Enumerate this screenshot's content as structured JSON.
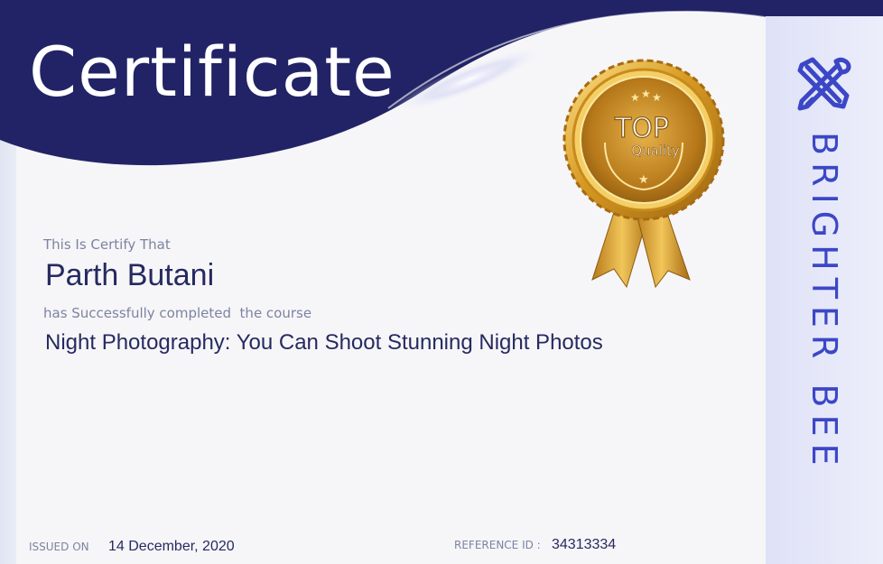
{
  "certificate": {
    "title": "Certificate",
    "certify_text": "This Is Certify That",
    "recipient_name": "Parth Butani",
    "completion_text": "has Successfully completed  the course",
    "course_name": "Night Photography: You Can Shoot Stunning Night Photos"
  },
  "footer": {
    "issued_label": "ISSUED ON",
    "issued_date": "14 December, 2020",
    "reference_label": "REFERENCE ID :",
    "reference_id": "34313334"
  },
  "badge": {
    "icon": "quality-seal-icon",
    "line1": "TOP",
    "line2": "Quality"
  },
  "brand": {
    "logo_icon": "crossed-pencil-brush-icon",
    "name": "BRIGHTER BEE"
  },
  "colors": {
    "header_navy": "#222366",
    "text_navy": "#262a60",
    "text_muted": "#7d83a1",
    "brand_blue": "#3c47c6",
    "gold": "#d9a22a"
  }
}
